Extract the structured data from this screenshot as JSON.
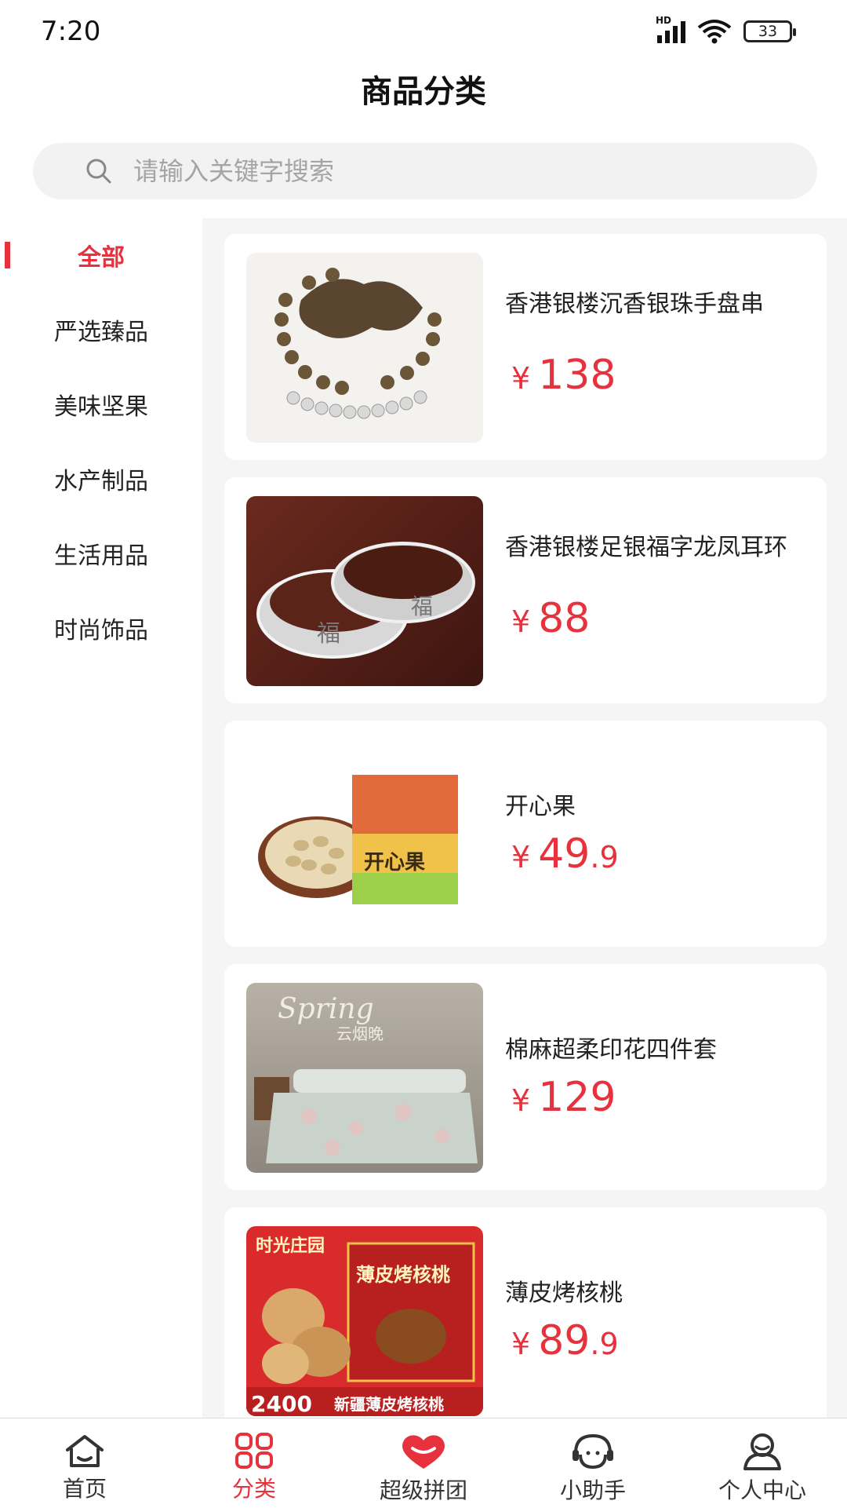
{
  "status_bar": {
    "time": "7:20",
    "network": "HD",
    "battery": "33"
  },
  "header": {
    "title": "商品分类"
  },
  "search": {
    "placeholder": "请输入关键字搜索"
  },
  "sidebar": {
    "items": [
      {
        "label": "全部",
        "active": true
      },
      {
        "label": "严选臻品",
        "active": false
      },
      {
        "label": "美味坚果",
        "active": false
      },
      {
        "label": "水产制品",
        "active": false
      },
      {
        "label": "生活用品",
        "active": false
      },
      {
        "label": "时尚饰品",
        "active": false
      }
    ]
  },
  "products": [
    {
      "name": "香港银楼沉香银珠手盘串",
      "currency": "¥",
      "price_int": "138",
      "price_dec": ""
    },
    {
      "name": "香港银楼足银福字龙凤耳环",
      "currency": "¥",
      "price_int": "88",
      "price_dec": ""
    },
    {
      "name": "开心果",
      "currency": "¥",
      "price_int": "49",
      "price_dec": ".9"
    },
    {
      "name": "棉麻超柔印花四件套",
      "currency": "¥",
      "price_int": "129",
      "price_dec": ""
    },
    {
      "name": "薄皮烤核桃",
      "currency": "¥",
      "price_int": "89",
      "price_dec": ".9"
    }
  ],
  "product_image_text": {
    "pistachio_package": "开心果",
    "bedding_script": "Spring",
    "bedding_title": "云烟晚",
    "walnut_brand": "时光庄园",
    "walnut_package": "薄皮烤核桃",
    "walnut_weight": "2400",
    "walnut_banner": "新疆薄皮烤核桃"
  },
  "tabbar": {
    "items": [
      {
        "label": "首页",
        "icon": "home-icon",
        "active": false
      },
      {
        "label": "分类",
        "icon": "category-grid-icon",
        "active": true
      },
      {
        "label": "超级拼团",
        "icon": "group-buy-heart-icon",
        "active": false
      },
      {
        "label": "小助手",
        "icon": "assistant-headset-icon",
        "active": false
      },
      {
        "label": "个人中心",
        "icon": "profile-icon",
        "active": false
      }
    ]
  },
  "colors": {
    "accent": "#e7313d",
    "background": "#f5f5f5"
  }
}
